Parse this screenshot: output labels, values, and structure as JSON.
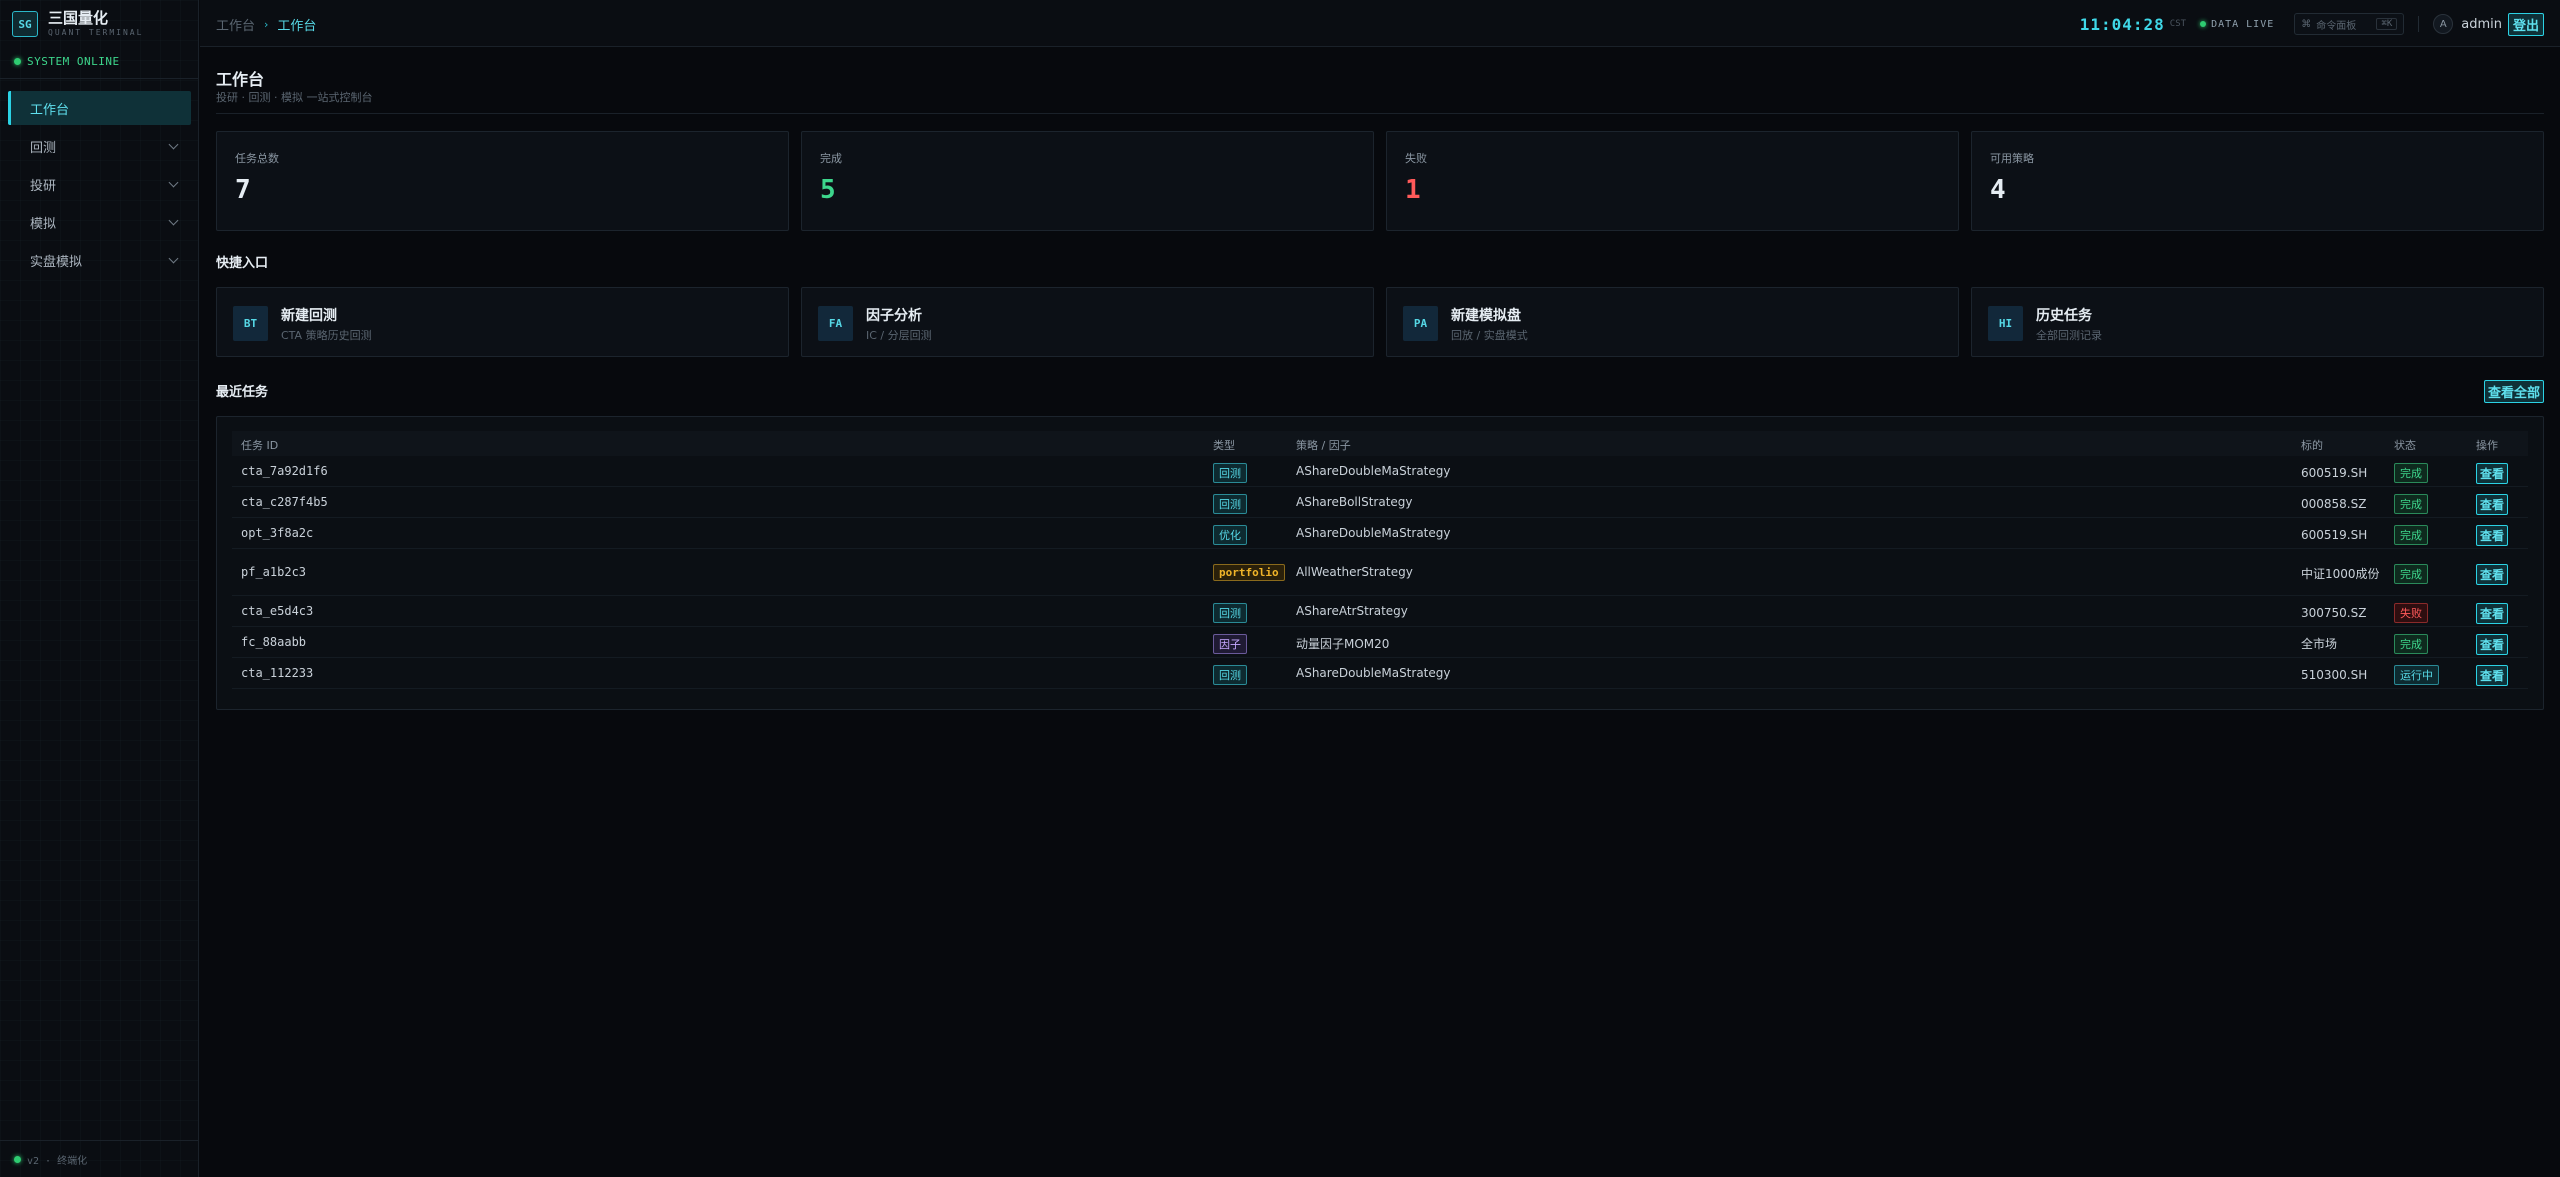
{
  "brand": {
    "logo": "SG",
    "name": "三国量化",
    "sub": "QUANT TERMINAL"
  },
  "sidebar": {
    "status": "SYSTEM ONLINE",
    "items": [
      {
        "label": "工作台",
        "active": true,
        "expandable": false
      },
      {
        "label": "回测",
        "active": false,
        "expandable": true
      },
      {
        "label": "投研",
        "active": false,
        "expandable": true
      },
      {
        "label": "模拟",
        "active": false,
        "expandable": true
      },
      {
        "label": "实盘模拟",
        "active": false,
        "expandable": true
      }
    ],
    "footer": "v2 · 终端化"
  },
  "header": {
    "breadcrumb_home": "工作台",
    "breadcrumb_sep": "›",
    "breadcrumb_current": "工作台",
    "clock": "11:04:28",
    "tz": "CST",
    "live": "DATA LIVE",
    "cmd_icon": "⌘",
    "cmd_label": "命令面板",
    "cmd_kbd": "⌘K",
    "avatar": "A",
    "user": "admin",
    "logout": "登出"
  },
  "page": {
    "title": "工作台",
    "subtitle": "投研 · 回测 · 模拟 一站式控制台"
  },
  "stats": [
    {
      "label": "任务总数",
      "value": "7",
      "color": "#e6edf3"
    },
    {
      "label": "完成",
      "value": "5",
      "color": "#3dd68c"
    },
    {
      "label": "失败",
      "value": "1",
      "color": "#ff5a5a"
    },
    {
      "label": "可用策略",
      "value": "4",
      "color": "#e6edf3"
    }
  ],
  "quick": {
    "title": "快捷入口",
    "items": [
      {
        "badge": "BT",
        "title": "新建回测",
        "sub": "CTA 策略历史回测"
      },
      {
        "badge": "FA",
        "title": "因子分析",
        "sub": "IC / 分层回测"
      },
      {
        "badge": "PA",
        "title": "新建模拟盘",
        "sub": "回放 / 实盘模式"
      },
      {
        "badge": "HI",
        "title": "历史任务",
        "sub": "全部回测记录"
      }
    ]
  },
  "recent": {
    "title": "最近任务",
    "view_all": "查看全部",
    "columns": [
      "任务 ID",
      "类型",
      "策略 / 因子",
      "标的",
      "状态",
      "操作"
    ],
    "rows": [
      {
        "id": "cta_7a92d1f6",
        "type": "回测",
        "type_style": "cyan",
        "strategy": "AShareDoubleMaStrategy",
        "symbol": "600519.SH",
        "status": "完成",
        "status_style": "done",
        "action": "查看"
      },
      {
        "id": "cta_c287f4b5",
        "type": "回测",
        "type_style": "cyan",
        "strategy": "AShareBollStrategy",
        "symbol": "000858.SZ",
        "status": "完成",
        "status_style": "done",
        "action": "查看"
      },
      {
        "id": "opt_3f8a2c",
        "type": "优化",
        "type_style": "cyan",
        "strategy": "AShareDoubleMaStrategy",
        "symbol": "600519.SH",
        "status": "完成",
        "status_style": "done",
        "action": "查看"
      },
      {
        "id": "pf_a1b2c3",
        "type": "portfolio",
        "type_style": "gold",
        "strategy": "AllWeatherStrategy",
        "symbol": "中证1000成份",
        "status": "完成",
        "status_style": "done",
        "action": "查看"
      },
      {
        "id": "cta_e5d4c3",
        "type": "回测",
        "type_style": "cyan",
        "strategy": "AShareAtrStrategy",
        "symbol": "300750.SZ",
        "status": "失败",
        "status_style": "fail",
        "action": "查看"
      },
      {
        "id": "fc_88aabb",
        "type": "因子",
        "type_style": "purple",
        "strategy": "动量因子MOM20",
        "symbol": "全市场",
        "status": "完成",
        "status_style": "done",
        "action": "查看"
      },
      {
        "id": "cta_112233",
        "type": "回测",
        "type_style": "cyan",
        "strategy": "AShareDoubleMaStrategy",
        "symbol": "510300.SH",
        "status": "运行中",
        "status_style": "run",
        "action": "查看"
      }
    ]
  }
}
